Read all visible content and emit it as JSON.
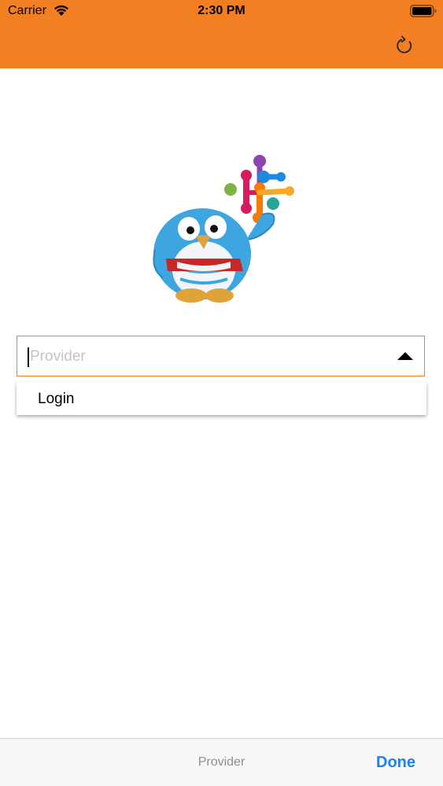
{
  "status_bar": {
    "carrier": "Carrier",
    "time": "2:30 PM"
  },
  "header": {
    "background_color": "#F27F22",
    "refresh_icon": "refresh-icon"
  },
  "provider_field": {
    "placeholder": "Provider",
    "value": "",
    "border_color": "#F27F22",
    "arrow_icon": "triangle-up-icon"
  },
  "dropdown": {
    "items": [
      {
        "label": "Login"
      }
    ]
  },
  "toolbar": {
    "title": "Provider",
    "done_label": "Done",
    "done_color": "#1E82E6"
  }
}
